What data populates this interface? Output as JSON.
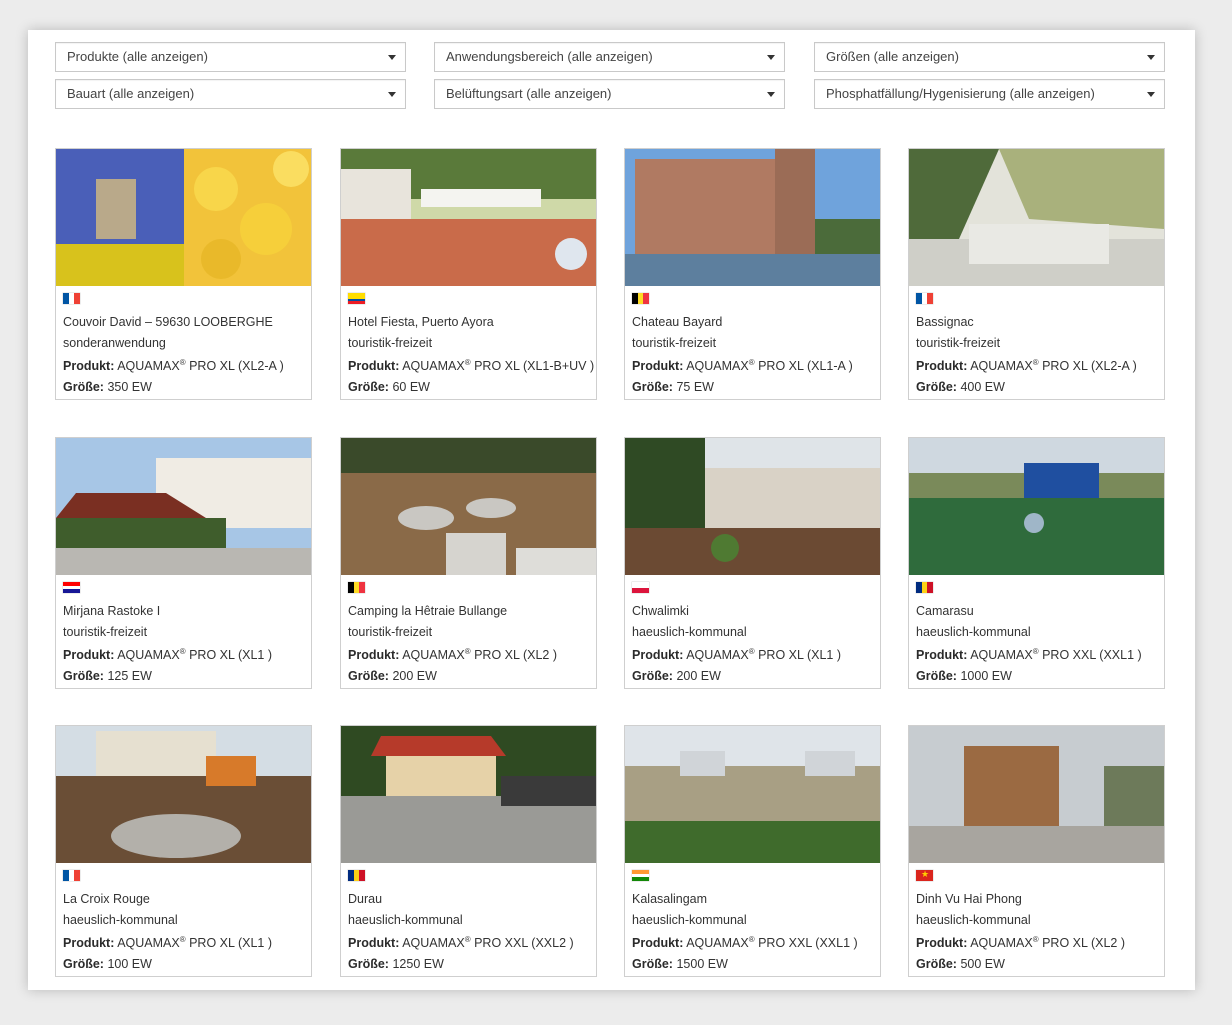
{
  "filters": [
    "Produkte (alle anzeigen)",
    "Anwendungsbereich (alle anzeigen)",
    "Größen (alle anzeigen)",
    "Bauart (alle anzeigen)",
    "Belüftungsart (alle anzeigen)",
    "Phosphatfällung/Hygenisierung (alle anzeigen)"
  ],
  "labels": {
    "product": "Produkt:",
    "size": "Größe:",
    "brand": "AQUAMAX",
    "reg": "®"
  },
  "projects": [
    {
      "title": "Couvoir David – 59630 LOOBERGHE",
      "category": "sonderanwendung",
      "product": "PRO XL (XL2-A )",
      "size": "350 EW",
      "flag": "france-flag-icon",
      "flag_colors": [
        "#0055a4",
        "#ffffff",
        "#ef4135"
      ],
      "flag_dir": "v"
    },
    {
      "title": "Hotel Fiesta, Puerto Ayora",
      "category": "touristik-freizeit",
      "product": "PRO XL (XL1-B+UV )",
      "size": "60 EW",
      "flag": "ecuador-flag-icon",
      "flag_colors": [
        "#ffdd00",
        "#ffdd00",
        "#034ea2",
        "#ed1c24"
      ],
      "flag_dir": "h"
    },
    {
      "title": "Chateau Bayard",
      "category": "touristik-freizeit",
      "product": "PRO XL (XL1-A )",
      "size": "75 EW",
      "flag": "belgium-flag-icon",
      "flag_colors": [
        "#000000",
        "#fdda24",
        "#ef3340"
      ],
      "flag_dir": "v"
    },
    {
      "title": "Bassignac",
      "category": "touristik-freizeit",
      "product": "PRO XL (XL2-A )",
      "size": "400 EW",
      "flag": "france-flag-icon",
      "flag_colors": [
        "#0055a4",
        "#ffffff",
        "#ef4135"
      ],
      "flag_dir": "v"
    },
    {
      "title": "Mirjana Rastoke I",
      "category": "touristik-freizeit",
      "product": "PRO XL (XL1 )",
      "size": "125 EW",
      "flag": "croatia-flag-icon",
      "flag_colors": [
        "#ff0000",
        "#ffffff",
        "#171796"
      ],
      "flag_dir": "h"
    },
    {
      "title": "Camping la Hêtraie Bullange",
      "category": "touristik-freizeit",
      "product": "PRO XL (XL2 )",
      "size": "200 EW",
      "flag": "belgium-flag-icon",
      "flag_colors": [
        "#000000",
        "#fdda24",
        "#ef3340"
      ],
      "flag_dir": "v"
    },
    {
      "title": "Chwalimki",
      "category": "haeuslich-kommunal",
      "product": "PRO XL (XL1 )",
      "size": "200 EW",
      "flag": "poland-flag-icon",
      "flag_colors": [
        "#ffffff",
        "#dc143c"
      ],
      "flag_dir": "h"
    },
    {
      "title": "Camarasu",
      "category": "haeuslich-kommunal",
      "product": "PRO XXL (XXL1 )",
      "size": "1000 EW",
      "flag": "romania-flag-icon",
      "flag_colors": [
        "#002b7f",
        "#fcd116",
        "#ce1126"
      ],
      "flag_dir": "v"
    },
    {
      "title": "La Croix Rouge",
      "category": "haeuslich-kommunal",
      "product": "PRO XL (XL1 )",
      "size": "100 EW",
      "flag": "france-flag-icon",
      "flag_colors": [
        "#0055a4",
        "#ffffff",
        "#ef4135"
      ],
      "flag_dir": "v"
    },
    {
      "title": "Durau",
      "category": "haeuslich-kommunal",
      "product": "PRO XXL (XXL2 )",
      "size": "1250 EW",
      "flag": "romania-flag-icon",
      "flag_colors": [
        "#002b7f",
        "#fcd116",
        "#ce1126"
      ],
      "flag_dir": "v"
    },
    {
      "title": "Kalasalingam",
      "category": "haeuslich-kommunal",
      "product": "PRO XXL (XXL1 )",
      "size": "1500 EW",
      "flag": "india-flag-icon",
      "flag_colors": [
        "#ff9933",
        "#ffffff",
        "#138808"
      ],
      "flag_dir": "h"
    },
    {
      "title": "Dinh Vu Hai Phong",
      "category": "haeuslich-kommunal",
      "product": "PRO XL (XL2 )",
      "size": "500 EW",
      "flag": "vietnam-flag-icon",
      "flag_colors": [
        "#da251d"
      ],
      "flag_dir": "v"
    }
  ]
}
